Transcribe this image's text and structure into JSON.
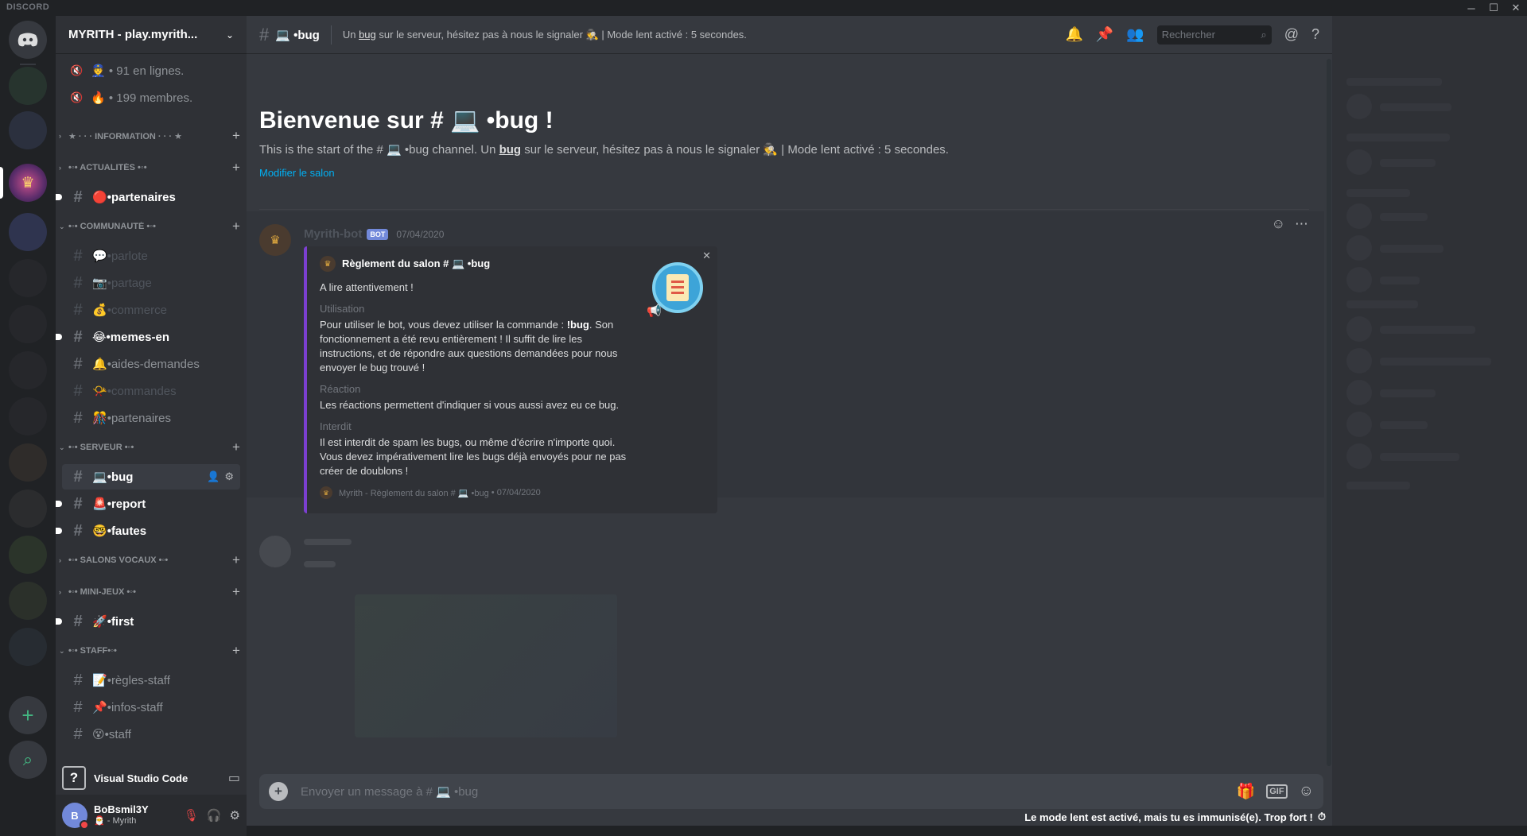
{
  "app": {
    "wordmark": "DISCORD"
  },
  "window": {
    "minimize": "─",
    "maximize": "☐",
    "close": "✕"
  },
  "rail": {
    "home_icon": "discord-logo-icon",
    "add_icon": "+",
    "explore_icon": "⌕"
  },
  "guild": {
    "name": "MYRITH - play.myrith...",
    "chevron": "⌄"
  },
  "stats": [
    {
      "emoji": "👮",
      "text": "• 91 en lignes."
    },
    {
      "emoji": "🔥",
      "text": "• 199 membres."
    }
  ],
  "categories": {
    "information": "★ · · · INFORMATION · · · ★",
    "actualites": "•◦• ACTUALITÉS •◦•",
    "communaute": "•◦• COMMUNAUTÉ •◦•",
    "serveur": "•◦• SERVEUR •◦•",
    "vocaux": "•◦• SALONS VOCAUX •◦•",
    "minijeux": "•◦• MINI-JEUX •◦•",
    "staff": "•◦• STAFF•◦•"
  },
  "channels": {
    "partenaires_news": {
      "emoji": "🔴",
      "name": "•partenaires"
    },
    "parlote": {
      "emoji": "💬",
      "name": "•parlote"
    },
    "partage": {
      "emoji": "📷",
      "name": "•partage"
    },
    "commerce": {
      "emoji": "💰",
      "name": "•commerce"
    },
    "memes": {
      "emoji": "😂",
      "name": "•memes-en"
    },
    "aides": {
      "emoji": "🔔",
      "name": "•aides-demandes"
    },
    "commandes": {
      "emoji": "📯",
      "name": "•commandes"
    },
    "partenaires": {
      "emoji": "🎊",
      "name": "•partenaires"
    },
    "bug": {
      "emoji": "💻",
      "name": "•bug"
    },
    "report": {
      "emoji": "🚨",
      "name": "•report"
    },
    "fautes": {
      "emoji": "🤓",
      "name": "•fautes"
    },
    "first": {
      "emoji": "🚀",
      "name": "•first"
    },
    "regles_staff": {
      "emoji": "📝",
      "name": "•règles-staff"
    },
    "infos_staff": {
      "emoji": "📌",
      "name": "•infos-staff"
    },
    "staff": {
      "emoji": "😵",
      "name": "•staff"
    }
  },
  "activity": {
    "icon": "?",
    "name": "Visual Studio Code"
  },
  "user": {
    "name": "BoBsmil3Y",
    "tag": "🎅 - Myrith",
    "initials": "B"
  },
  "header": {
    "channel": "💻 •bug",
    "topic_pre": "Un ",
    "topic_bold": "bug",
    "topic_post": " sur le serveur, hésitez pas à nous le signaler 🕵️ | Mode lent activé : 5 secondes.",
    "search_placeholder": "Rechercher"
  },
  "welcome": {
    "title": "Bienvenue sur # 💻 •bug !",
    "desc_pre": "This is the start of the # 💻 •bug channel. Un ",
    "desc_bold": "bug",
    "desc_post": " sur le serveur, hésitez pas à nous le signaler 🕵️ | Mode lent activé : 5 secondes.",
    "edit_link": "Modifier le salon"
  },
  "message": {
    "author": "Myrith-bot",
    "bot_tag": "BOT",
    "time": "07/04/2020",
    "embed": {
      "author": "Règlement du salon # 💻 •bug",
      "description": "A lire attentivement !",
      "fields": [
        {
          "name": "Utilisation",
          "pre": "Pour utiliser le bot, vous devez utiliser la commande : ",
          "bold": "!bug",
          "post": ". Son fonctionnement a été revu entièrement ! Il suffit de lire les instructions, et de répondre aux questions demandées pour nous envoyer le bug trouvé !"
        },
        {
          "name": "Réaction",
          "text": "Les réactions permettent d'indiquer si vous aussi avez eu ce bug."
        },
        {
          "name": "Interdit",
          "text": "Il est interdit de spam les bugs, ou même d'écrire n'importe quoi. Vous devez impérativement lire les bugs déjà envoyés pour ne pas créer de doublons !"
        }
      ],
      "footer": "Myrith - Règlement du salon # 💻 •bug",
      "footer_time": "07/04/2020"
    }
  },
  "composer": {
    "placeholder": "Envoyer un message à # 💻 •bug",
    "gif": "GIF"
  },
  "slowmode": {
    "text": "Le mode lent est activé, mais tu es immunisé(e). Trop fort !",
    "icon": "⏱"
  },
  "colors": {
    "accent": "#7289da",
    "embed_bar": "#7b3fd0",
    "link": "#00b0f4",
    "dnd": "#f04747"
  }
}
